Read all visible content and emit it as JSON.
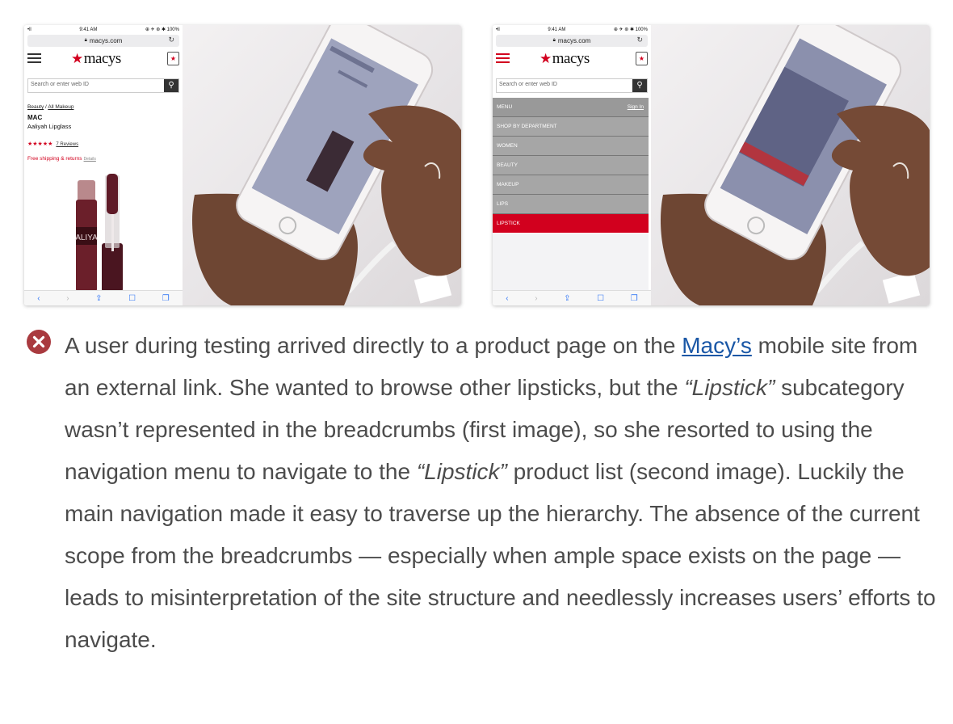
{
  "figure1": {
    "status": {
      "signal": "•ll ",
      "time": "9:41 AM",
      "battery": "⊕ ✈ ⊛ ✱ 100%"
    },
    "url": "macys.com",
    "logo": "macys",
    "search_placeholder": "Search or enter web ID",
    "breadcrumb": {
      "item1": "Beauty",
      "separator": " / ",
      "item2": "All Makeup"
    },
    "product_brand": "MAC",
    "product_name": "Aaliyah Lipglass",
    "rating_stars": "★★★★★",
    "reviews": "7 Reviews",
    "shipping": "Free shipping & returns",
    "details": "Details",
    "product_label": "ALIYA"
  },
  "figure2": {
    "status": {
      "signal": "•ll ",
      "time": "9:41 AM",
      "battery": "⊕ ✈ ⊛ ✱ 100%"
    },
    "url": "macys.com",
    "logo": "macys",
    "search_placeholder": "Search or enter web ID",
    "menu_title": "MENU",
    "sign_in": "Sign In",
    "menu_items": [
      "SHOP BY DEPARTMENT",
      "WOMEN",
      "BEAUTY",
      "MAKEUP",
      "LIPS",
      "LIPSTICK"
    ]
  },
  "caption": {
    "part1": "A user during testing arrived directly to a product page on the ",
    "link": "Macy’s",
    "part2": " mobile site from an external link. She wanted to browse other lipsticks, but the ",
    "em1": "“Lipstick”",
    "part3": " subcategory wasn’t represented in the breadcrumbs (first image), so she resorted to using the navigation menu to navigate to the ",
    "em2": "“Lipstick”",
    "part4": " product list (second image). Luckily the main navigation made it easy to traverse up the hierarchy. The absence of the current scope from the breadcrumbs — especially when ample space exists on the page — leads to misinterpretation of the site structure and needlessly increases users’ efforts to navigate."
  },
  "colors": {
    "brand_red": "#d2001e",
    "error_icon": "#a93a3f",
    "link": "#1a57a6",
    "text": "#4c4c4c"
  }
}
